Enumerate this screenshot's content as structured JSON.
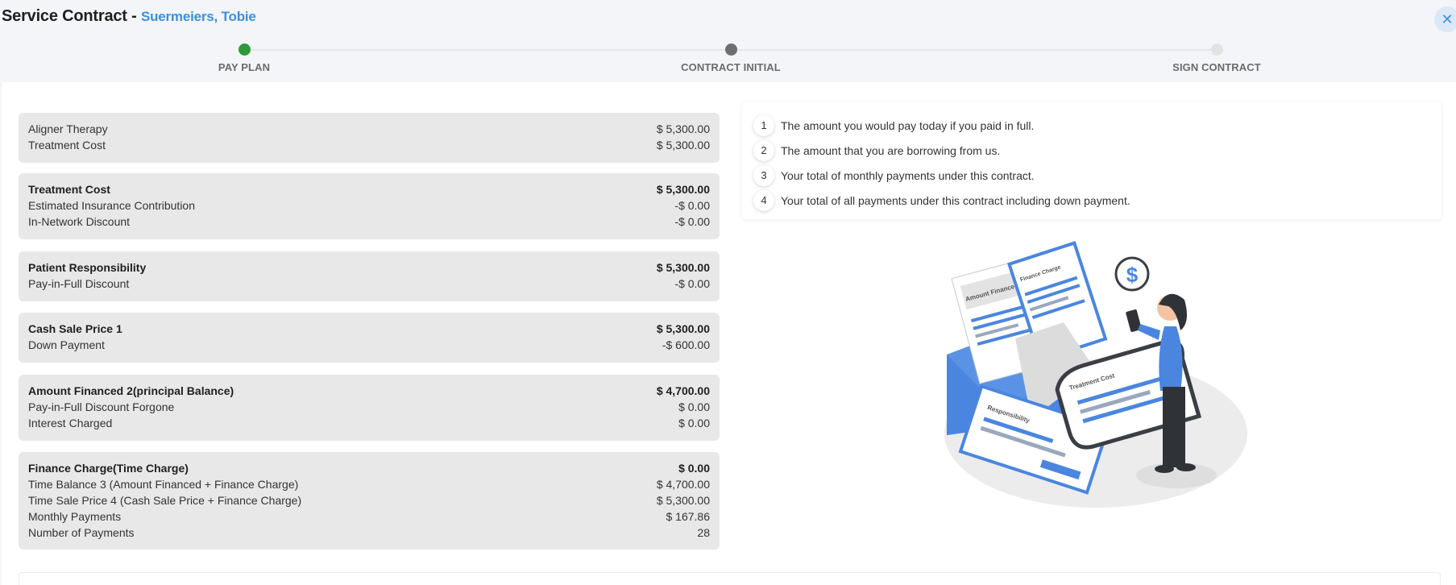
{
  "header": {
    "title": "Service Contract -",
    "patient_name": "Suermeiers, Tobie",
    "close_icon": "close-icon"
  },
  "stepper": {
    "steps": [
      {
        "label": "PAY PLAN",
        "color": "#2e9a3c"
      },
      {
        "label": "CONTRACT INITIAL",
        "color": "#6e6e6e"
      },
      {
        "label": "SIGN CONTRACT",
        "color": "#e2e2e2"
      }
    ]
  },
  "cards": [
    {
      "rows": [
        {
          "label": "Aligner Therapy",
          "value": "$ 5,300.00",
          "bold": false
        },
        {
          "label": "Treatment Cost",
          "value": "$ 5,300.00",
          "bold": false
        }
      ]
    },
    {
      "rows": [
        {
          "label": "Treatment Cost",
          "value": "$ 5,300.00",
          "bold": true
        },
        {
          "label": "Estimated Insurance Contribution",
          "value": "-$ 0.00",
          "bold": false
        },
        {
          "label": "In-Network Discount",
          "value": "-$ 0.00",
          "bold": false
        }
      ]
    },
    {
      "rows": [
        {
          "label": "Patient Responsibility",
          "value": "$ 5,300.00",
          "bold": true
        },
        {
          "label": "Pay-in-Full Discount",
          "value": "-$ 0.00",
          "bold": false
        }
      ]
    },
    {
      "rows": [
        {
          "label": "Cash Sale Price 1",
          "value": "$ 5,300.00",
          "bold": true
        },
        {
          "label": "Down Payment",
          "value": "-$ 600.00",
          "bold": false
        }
      ]
    },
    {
      "rows": [
        {
          "label": "Amount Financed 2(principal Balance)",
          "value": "$ 4,700.00",
          "bold": true
        },
        {
          "label": "Pay-in-Full Discount Forgone",
          "value": "$ 0.00",
          "bold": false
        },
        {
          "label": "Interest Charged",
          "value": "$ 0.00",
          "bold": false
        }
      ]
    },
    {
      "rows": [
        {
          "label": "Finance Charge(Time Charge)",
          "value": "$ 0.00",
          "bold": true
        },
        {
          "label": "Time Balance 3 (Amount Financed + Finance Charge)",
          "value": "$ 4,700.00",
          "bold": false
        },
        {
          "label": "Time Sale Price 4 (Cash Sale Price + Finance Charge)",
          "value": "$ 5,300.00",
          "bold": false
        },
        {
          "label": "Monthly Payments",
          "value": "$ 167.86",
          "bold": false
        },
        {
          "label": "Number of Payments",
          "value": "28",
          "bold": false
        }
      ]
    }
  ],
  "info": {
    "items": [
      {
        "num": "1",
        "text": "The amount you would pay today if you paid in full."
      },
      {
        "num": "2",
        "text": "The amount that you are borrowing from us."
      },
      {
        "num": "3",
        "text": "Your total of monthly payments under this contract."
      },
      {
        "num": "4",
        "text": "Your total of all payments under this contract including down payment."
      }
    ]
  },
  "illustration": {
    "doc_labels": [
      "Amount Financed",
      "Finance Charge",
      "Responsibility",
      "Treatment Cost"
    ],
    "bubble_symbol": "$"
  },
  "colors": {
    "accent": "#3d8fe0",
    "card_bg": "#e8e8e8",
    "step_done": "#2e9a3c"
  }
}
